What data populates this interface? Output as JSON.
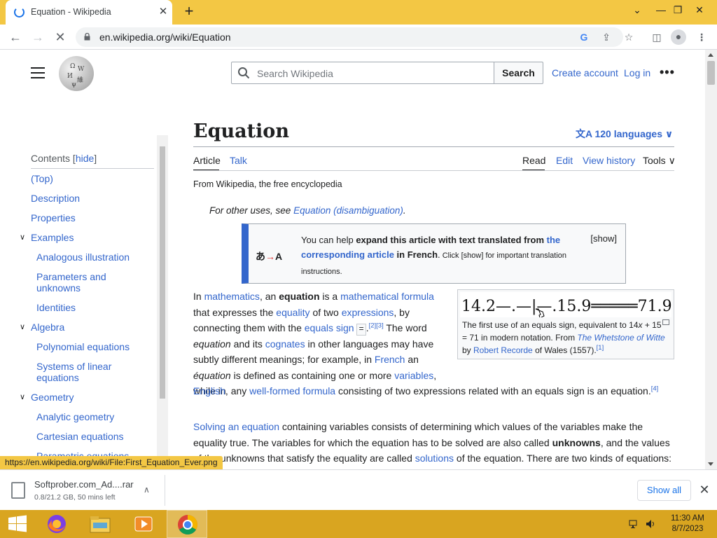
{
  "browser": {
    "tab_title": "Equation - Wikipedia",
    "new_tab_symbol": "+",
    "url": "en.wikipedia.org/wiki/Equation",
    "status_url": "https://en.wikipedia.org/wiki/File:First_Equation_Ever.png"
  },
  "header": {
    "search_placeholder": "Search Wikipedia",
    "search_button": "Search",
    "create_account": "Create account",
    "log_in": "Log in"
  },
  "toc": {
    "heading": "Contents",
    "hide": "hide",
    "items": [
      {
        "label": "(Top)"
      },
      {
        "label": "Description"
      },
      {
        "label": "Properties"
      },
      {
        "label": "Examples"
      },
      {
        "label": "Analogous illustration"
      },
      {
        "label": "Parameters and unknowns"
      },
      {
        "label": "Identities"
      },
      {
        "label": "Algebra"
      },
      {
        "label": "Polynomial equations"
      },
      {
        "label": "Systems of linear equations"
      },
      {
        "label": "Geometry"
      },
      {
        "label": "Analytic geometry"
      },
      {
        "label": "Cartesian equations"
      },
      {
        "label": "Parametric equations"
      }
    ]
  },
  "article": {
    "title": "Equation",
    "languages": "120 languages",
    "tabs": {
      "article": "Article",
      "talk": "Talk",
      "read": "Read",
      "edit": "Edit",
      "history": "View history",
      "tools": "Tools"
    },
    "from_wiki": "From Wikipedia, the free encyclopedia",
    "hatnote": {
      "prefix": "For other uses, see ",
      "link": "Equation (disambiguation)",
      "suffix": "."
    },
    "ambox": {
      "icon_text": "あ",
      "icon_letter": "A",
      "text1": "You can help ",
      "bold1": "expand this article with text translated from ",
      "link": "the corresponding article",
      "bold2": " in French",
      "text2": ".",
      "small": " Click [show] for important translation instructions.",
      "show": "[show]"
    },
    "thumb": {
      "image_text": "14.2—.—|—.15.9═════71.9.",
      "cap1": "The first use of an equals sign, equivalent to 14",
      "cap_x": "x",
      "cap2": " + 15 = 71 in modern notation. From ",
      "cap_link1": "The Whetstone of Witte",
      "cap3": " by ",
      "cap_link2": "Robert Recorde",
      "cap4": " of Wales (1557).",
      "cap_ref": "[1]"
    },
    "p1": {
      "s1": "In ",
      "l1": "mathematics",
      "s2": ", an ",
      "b1": "equation",
      "s3": " is a ",
      "l2": "mathematical formula",
      "s4": " that expresses the ",
      "l3": "equality",
      "s5": " of two ",
      "l4": "expressions",
      "s6": ", by connecting them with the ",
      "l5": "equals sign",
      "s7": " ",
      "eq": "=",
      "s8": ".",
      "ref1": "[2][3]",
      "s9": " The word ",
      "i1": "equation",
      "s10": " and its ",
      "l6": "cognates",
      "s11": " in other languages may have subtly different meanings; for example, in ",
      "l7": "French",
      "s12": " an ",
      "i2": "équation",
      "s13": " is defined as containing one or more ",
      "l8": "variables",
      "s14": ", while in ",
      "l9": "English",
      "s15": ", any ",
      "l10": "well-formed formula",
      "s16": " consisting of two expressions related with an equals sign is an equation.",
      "ref2": "[4]"
    },
    "p2": {
      "l1": "Solving an equation",
      "s1": " containing variables consists of determining which values of the variables make the equality true. The variables for which the equation has to be solved are also called ",
      "b1": "unknowns",
      "s2": ", and the values of the unknowns that satisfy the equality are called ",
      "l2": "solutions",
      "s3": " of the equation. There are two kinds of equations:"
    }
  },
  "download": {
    "filename": "Softprober.com_Ad....rar",
    "progress": "0.8/21.2 GB, 50 mins left",
    "show_all": "Show all"
  },
  "taskbar": {
    "time": "11:30 AM",
    "date": "8/7/2023"
  },
  "colors": {
    "chrome_frame": "#f3c744",
    "taskbar": "#d9a520",
    "wiki_link": "#3366cc"
  }
}
